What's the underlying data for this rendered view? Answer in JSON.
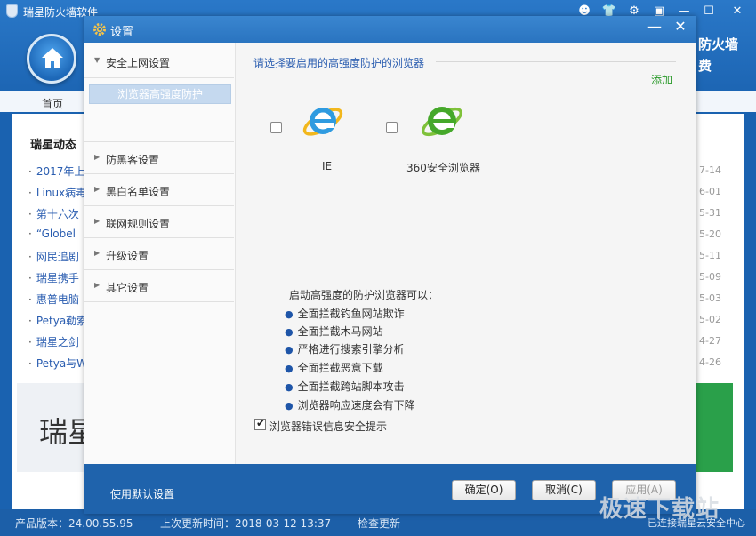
{
  "app": {
    "title": "瑞星防火墙软件",
    "brand_right": [
      "防火墙",
      "费"
    ],
    "nav_home": "首页",
    "news_title": "瑞星动态",
    "news": [
      {
        "text": "2017年上",
        "date": "7-14"
      },
      {
        "text": "Linux病毒",
        "date": "6-01"
      },
      {
        "text": "第十六次",
        "date": "5-31"
      },
      {
        "text": "“Globel",
        "date": "5-20"
      },
      {
        "text": "网民追剧",
        "date": "5-11"
      },
      {
        "text": "瑞星携手",
        "date": "5-09"
      },
      {
        "text": "惠普电脑",
        "date": "5-03"
      },
      {
        "text": "Petya勒索",
        "date": "5-02"
      },
      {
        "text": "瑞星之剑",
        "date": "4-27"
      },
      {
        "text": "Petya与W",
        "date": "4-26"
      }
    ],
    "banner_text": "瑞星",
    "status": {
      "version": "产品版本：24.00.55.95",
      "last_update": "上次更新时间：2018-03-12 13:37",
      "check_update": "检查更新",
      "cloud": "已连接瑞星云安全中心"
    }
  },
  "dialog": {
    "title": "设置",
    "sidebar": {
      "sections": [
        {
          "label": "安全上网设置",
          "expanded": true
        },
        {
          "label": "防黑客设置",
          "expanded": false
        },
        {
          "label": "黑白名单设置",
          "expanded": false
        },
        {
          "label": "联网规则设置",
          "expanded": false
        },
        {
          "label": "升级设置",
          "expanded": false
        },
        {
          "label": "其它设置",
          "expanded": false
        }
      ],
      "selected_sub": "浏览器高强度防护"
    },
    "panel": {
      "title": "请选择要启用的高强度防护的浏览器",
      "add_link": "添加",
      "browsers": [
        {
          "name": "IE",
          "checked": false
        },
        {
          "name": "360安全浏览器",
          "checked": false
        }
      ],
      "intro": "启动高强度的防护浏览器可以：",
      "features": [
        "全面拦截钓鱼网站欺诈",
        "全面拦截木马网站",
        "严格进行搜索引擎分析",
        "全面拦截恶意下载",
        "全面拦截跨站脚本攻击",
        "浏览器响应速度会有下降"
      ],
      "security_tip_label": "浏览器错误信息安全提示",
      "security_tip_checked": true
    },
    "footer": {
      "reset_label": "使用默认设置",
      "ok_label": "确定(O)",
      "cancel_label": "取消(C)",
      "apply_label": "应用(A)"
    }
  },
  "watermark": {
    "text": "极速下载站"
  },
  "colors": {
    "title_blue": "#2a74c0",
    "footer_blue": "#1f63ac",
    "link_blue": "#2a5db0",
    "add_green": "#2a9a2a",
    "selected_sub_bg": "#c5d9ef"
  },
  "icons": {
    "home": "home-icon",
    "gear": "gear-icon",
    "ie": "ie-logo",
    "browser360": "360-browser-logo"
  }
}
